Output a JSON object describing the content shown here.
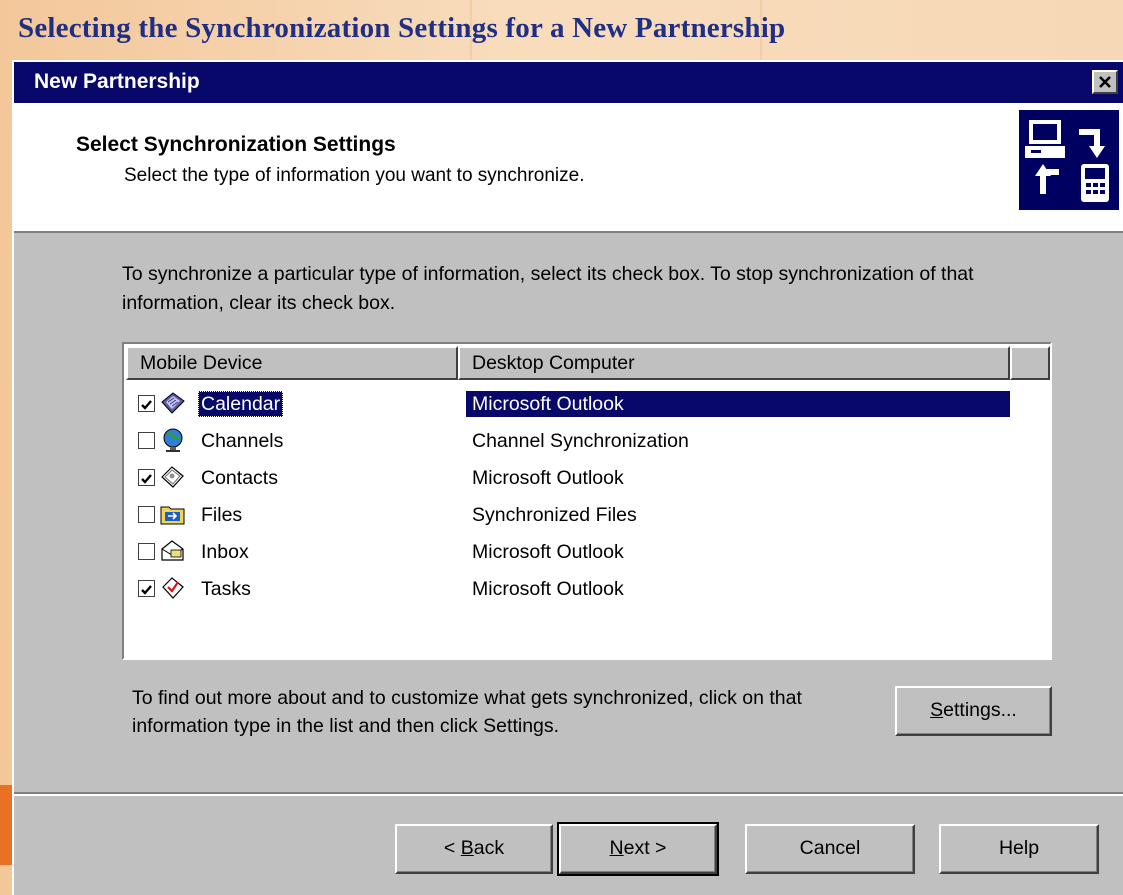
{
  "slide": {
    "title": "Selecting the Synchronization Settings for a New Partnership"
  },
  "dialog": {
    "title": "New Partnership",
    "close_glyph": "✕",
    "header": {
      "title": "Select Synchronization Settings",
      "subtitle": "Select the type of information you want to synchronize."
    },
    "instructions": "To synchronize a particular type of information, select its check box. To stop synchronization of that information, clear its check box.",
    "list": {
      "columns": [
        "Mobile Device",
        "Desktop Computer"
      ],
      "rows": [
        {
          "name": "Calendar",
          "desktop": "Microsoft Outlook",
          "checked": true,
          "selected": true,
          "icon": "calendar-icon"
        },
        {
          "name": "Channels",
          "desktop": "Channel Synchronization",
          "checked": false,
          "selected": false,
          "icon": "channels-icon"
        },
        {
          "name": "Contacts",
          "desktop": "Microsoft Outlook",
          "checked": true,
          "selected": false,
          "icon": "contacts-icon"
        },
        {
          "name": "Files",
          "desktop": "Synchronized Files",
          "checked": false,
          "selected": false,
          "icon": "files-icon"
        },
        {
          "name": "Inbox",
          "desktop": "Microsoft Outlook",
          "checked": false,
          "selected": false,
          "icon": "inbox-icon"
        },
        {
          "name": "Tasks",
          "desktop": "Microsoft Outlook",
          "checked": true,
          "selected": false,
          "icon": "tasks-icon"
        }
      ]
    },
    "settings_help": "To find out more about and to customize what gets synchronized, click on that information type in the list and then click Settings.",
    "buttons": {
      "settings": {
        "mnemonic": "S",
        "rest": "ettings..."
      },
      "back": {
        "pre": "< ",
        "mnemonic": "B",
        "rest": "ack"
      },
      "next": {
        "mnemonic": "N",
        "rest": "ext >"
      },
      "cancel": "Cancel",
      "help": "Help"
    },
    "colors": {
      "title_bar": "#08086b",
      "selection": "#08086b",
      "face": "#c0c0c0",
      "slide_title": "#1f2f86"
    }
  }
}
